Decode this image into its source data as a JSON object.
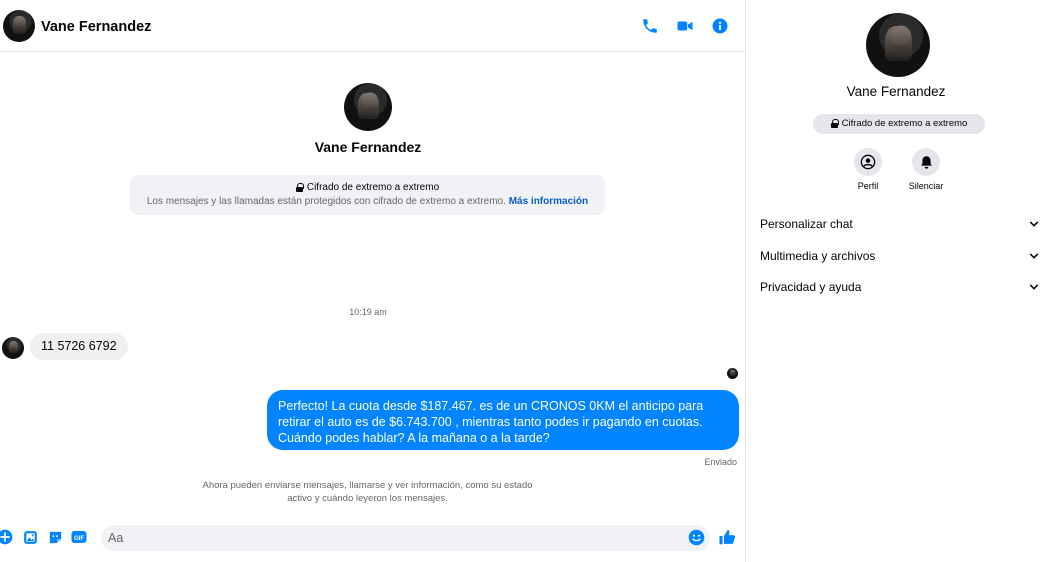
{
  "header": {
    "contact_name": "Vane Fernandez",
    "icons": [
      "phone-icon",
      "video-camera-icon",
      "info-icon"
    ]
  },
  "conversation_intro": {
    "name": "Vane Fernandez",
    "e2e_title": "Cifrado de extremo a extremo",
    "e2e_text": "Los mensajes y las llamadas están protegidos con cifrado de extremo a extremo.",
    "e2e_link": "Más información"
  },
  "messages": {
    "timestamp": "10:19 am",
    "incoming": "11 5726 6792",
    "outgoing": "Perfecto! La cuota desde $187.467. es de un CRONOS 0KM el anticipo para retirar el auto es de $6.743.700 , mientras tanto podes ir pagando en cuotas. Cuándo podes hablar? A la mañana o a la tarde?",
    "status": "Enviado"
  },
  "info_note": "Ahora pueden enviarse mensajes, llamarse y ver información, como su estado activo y cuándo leyeron los mensajes.",
  "composer": {
    "placeholder": "Aa",
    "icons": [
      "plus-icon",
      "image-icon",
      "sticker-icon",
      "gif-icon",
      "emoji-icon",
      "thumbs-up-icon"
    ],
    "gif_label": "GIF"
  },
  "info_panel": {
    "name": "Vane Fernandez",
    "e2e_badge": "Cifrado de extremo a extremo",
    "actions": [
      {
        "label": "Perfil",
        "icon": "profile-icon"
      },
      {
        "label": "Silenciar",
        "icon": "bell-icon"
      }
    ],
    "sections": [
      "Personalizar chat",
      "Multimedia y archivos",
      "Privacidad y ayuda"
    ]
  },
  "colors": {
    "accent": "#0084ff",
    "link": "#0a5bc8",
    "secondary_text": "#65676b",
    "bubble_gray": "#f0f0f0"
  }
}
